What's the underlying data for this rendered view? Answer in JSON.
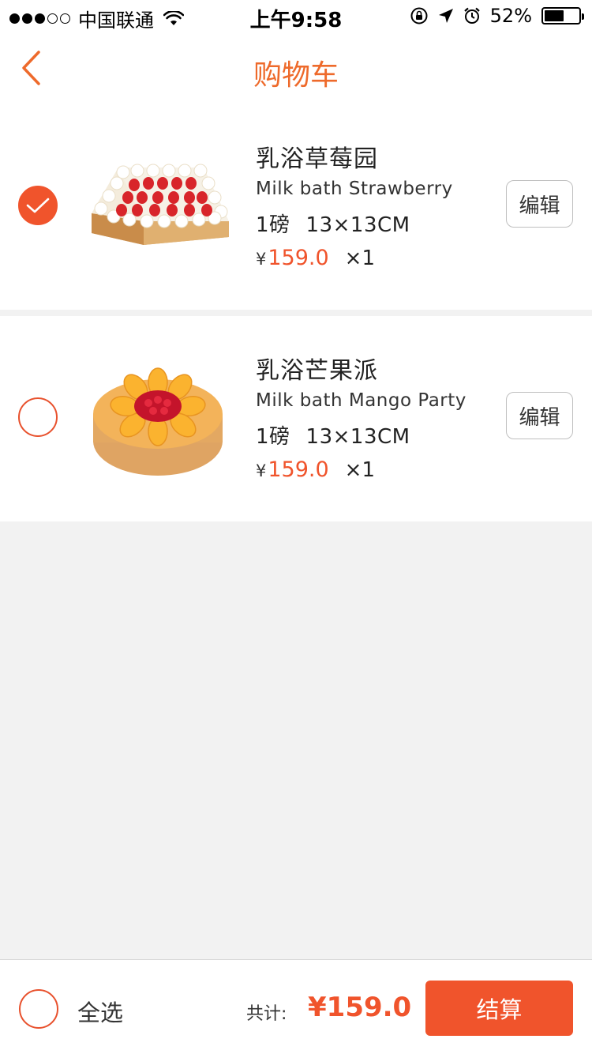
{
  "status_bar": {
    "carrier": "中国联通",
    "time": "上午9:58",
    "battery_percent": "52%",
    "battery_level": 0.52,
    "signal_full_dots": 3,
    "signal_total_dots": 5
  },
  "nav": {
    "title": "购物车",
    "back_icon": "chevron-left-icon"
  },
  "colors": {
    "accent": "#f0542c",
    "title": "#ee6a2b",
    "background": "#f2f2f2"
  },
  "cart": {
    "items": [
      {
        "name_cn": "乳浴草莓园",
        "name_en": "Milk bath Strawberry",
        "weight": "1磅",
        "size": "13×13CM",
        "currency": "¥",
        "price": "159.0",
        "qty": "×1",
        "edit_label": "编辑",
        "checked": true
      },
      {
        "name_cn": "乳浴芒果派",
        "name_en": "Milk bath Mango Party",
        "weight": "1磅",
        "size": "13×13CM",
        "currency": "¥",
        "price": "159.0",
        "qty": "×1",
        "edit_label": "编辑",
        "checked": false
      }
    ]
  },
  "footer": {
    "select_all_label": "全选",
    "total_label": "共计:",
    "total_value": "¥159.0",
    "checkout_label": "结算"
  }
}
